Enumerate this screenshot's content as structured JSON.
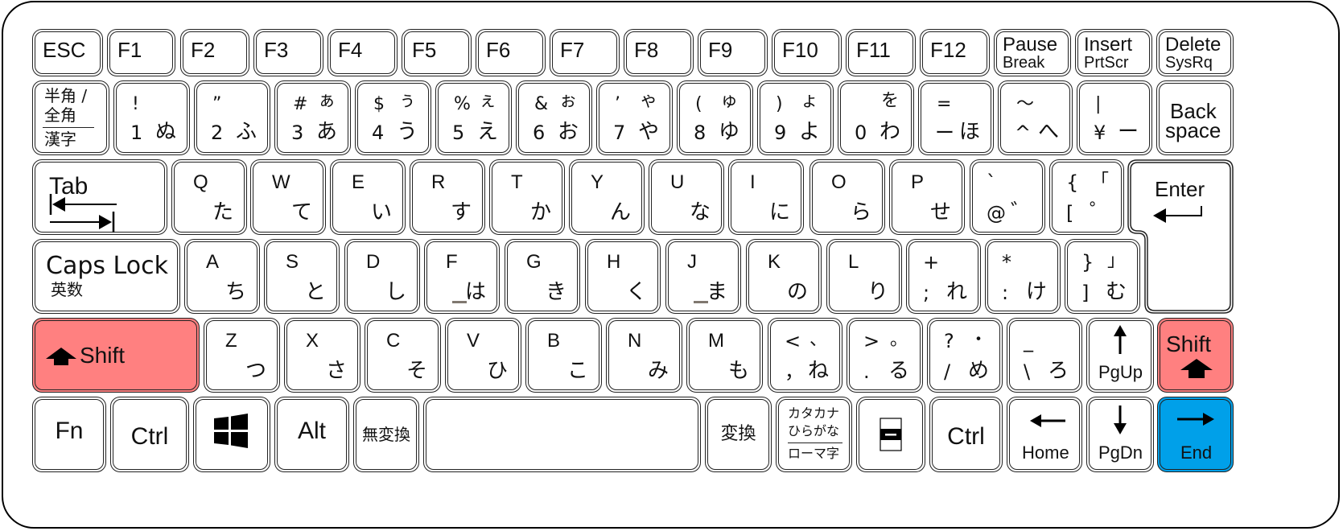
{
  "keyboard": {
    "layout": "JIS Japanese keyboard",
    "highlight_colors": {
      "shift": "#ff8080",
      "end": "#00a0e9"
    },
    "function_row": [
      "ESC",
      "F1",
      "F2",
      "F3",
      "F4",
      "F5",
      "F6",
      "F7",
      "F8",
      "F9",
      "F10",
      "F11",
      "F12"
    ],
    "pause": {
      "top": "Pause",
      "bottom": "Break"
    },
    "insert": {
      "top": "Insert",
      "bottom": "PrtScr"
    },
    "delete": {
      "top": "Delete",
      "bottom": "SysRq"
    },
    "hankaku": {
      "line1": "半角 /",
      "line2": "全角",
      "line3": "漢字"
    },
    "number_row": [
      {
        "shift": "!",
        "shift_kana": "",
        "num": "1",
        "kana": "ぬ"
      },
      {
        "shift": "”",
        "shift_kana": "",
        "num": "2",
        "kana": "ふ"
      },
      {
        "shift": "#",
        "shift_kana": "ぁ",
        "num": "3",
        "kana": "あ"
      },
      {
        "shift": "$",
        "shift_kana": "ぅ",
        "num": "4",
        "kana": "う"
      },
      {
        "shift": "%",
        "shift_kana": "ぇ",
        "num": "5",
        "kana": "え"
      },
      {
        "shift": "&",
        "shift_kana": "ぉ",
        "num": "6",
        "kana": "お"
      },
      {
        "shift": "’",
        "shift_kana": "ゃ",
        "num": "7",
        "kana": "や"
      },
      {
        "shift": "(",
        "shift_kana": "ゅ",
        "num": "8",
        "kana": "ゆ"
      },
      {
        "shift": ")",
        "shift_kana": "ょ",
        "num": "9",
        "kana": "よ"
      },
      {
        "shift": "",
        "shift_kana": "を",
        "num": "0",
        "kana": "わ"
      },
      {
        "shift": "=",
        "shift_kana": "",
        "num": "ー",
        "kana": "ほ"
      },
      {
        "shift": "〜",
        "shift_kana": "",
        "num": "^",
        "kana": "へ"
      },
      {
        "shift": "|",
        "shift_kana": "",
        "num": "¥",
        "kana": "ー"
      }
    ],
    "backspace": {
      "line1": "Back",
      "line2": "space"
    },
    "tab": "Tab",
    "qwerty_row": [
      {
        "letter": "Q",
        "kana": "た"
      },
      {
        "letter": "W",
        "kana": "て"
      },
      {
        "letter": "E",
        "kana": "い"
      },
      {
        "letter": "R",
        "kana": "す"
      },
      {
        "letter": "T",
        "kana": "か"
      },
      {
        "letter": "Y",
        "kana": "ん"
      },
      {
        "letter": "U",
        "kana": "な"
      },
      {
        "letter": "I",
        "kana": "に"
      },
      {
        "letter": "O",
        "kana": "ら"
      },
      {
        "letter": "P",
        "kana": "せ"
      }
    ],
    "at_key": {
      "shift": "`",
      "num": "@",
      "kana": "゛"
    },
    "bracket_open_key": {
      "shift": "{",
      "shift_kana": "「",
      "num": "[",
      "kana": "゜"
    },
    "enter": "Enter",
    "caps": {
      "line1": "Caps Lock",
      "line2": "英数"
    },
    "home_row": [
      {
        "letter": "A",
        "kana": "ち"
      },
      {
        "letter": "S",
        "kana": "と"
      },
      {
        "letter": "D",
        "kana": "し"
      },
      {
        "letter": "F",
        "kana": "は"
      },
      {
        "letter": "G",
        "kana": "き"
      },
      {
        "letter": "H",
        "kana": "く"
      },
      {
        "letter": "J",
        "kana": "ま"
      },
      {
        "letter": "K",
        "kana": "の"
      },
      {
        "letter": "L",
        "kana": "り"
      }
    ],
    "semicolon_key": {
      "shift": "+",
      "num": ";",
      "kana": "れ"
    },
    "colon_key": {
      "shift": "*",
      "num": ":",
      "kana": "け"
    },
    "bracket_close_key": {
      "shift": "}",
      "shift_kana": "」",
      "num": "]",
      "kana": "む"
    },
    "shift": "Shift",
    "bottom_alpha_row": [
      {
        "letter": "Z",
        "kana": "つ"
      },
      {
        "letter": "X",
        "kana": "さ"
      },
      {
        "letter": "C",
        "kana": "そ"
      },
      {
        "letter": "V",
        "kana": "ひ"
      },
      {
        "letter": "B",
        "kana": "こ"
      },
      {
        "letter": "N",
        "kana": "み"
      },
      {
        "letter": "M",
        "kana": "も"
      }
    ],
    "comma_key": {
      "shift": "<",
      "shift_kana": "、",
      "num": "，",
      "kana": "ね"
    },
    "period_key": {
      "shift": ">",
      "shift_kana": "。",
      "num": ".",
      "kana": "る"
    },
    "slash_key": {
      "shift": "?",
      "shift_kana": "・",
      "num": "/",
      "kana": "め"
    },
    "backslash_key": {
      "shift": "_",
      "num": "\\",
      "kana": "ろ"
    },
    "pgup": "PgUp",
    "pgdn": "PgDn",
    "home": "Home",
    "end": "End",
    "fn": "Fn",
    "ctrl": "Ctrl",
    "alt": "Alt",
    "muhenkan": "無変換",
    "henkan": "変換",
    "kana_key": {
      "line1": "カタカナ",
      "line2": "ひらがな",
      "line3": "ローマ字"
    }
  }
}
